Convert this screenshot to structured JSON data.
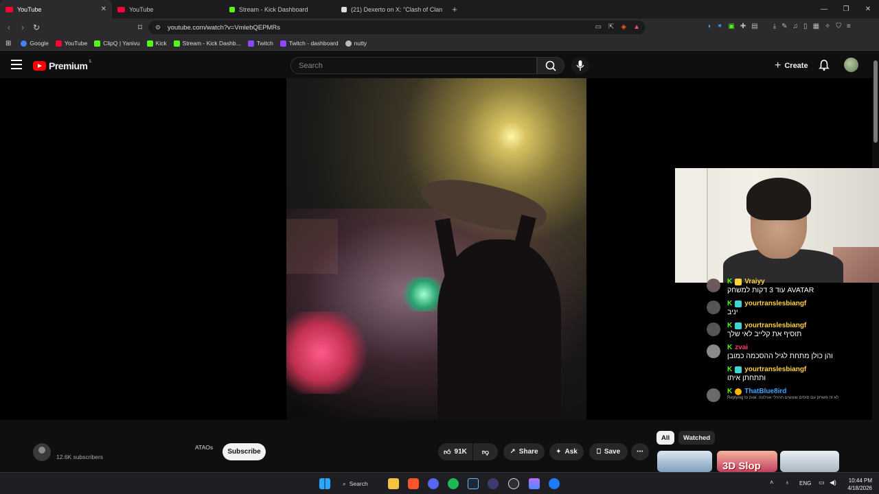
{
  "browser": {
    "tabs": [
      {
        "title": "YouTube",
        "active": true,
        "favicon_color": "#ff0033"
      },
      {
        "title": "YouTube",
        "active": false,
        "favicon_color": "#ff0033"
      },
      {
        "title": "Stream - Kick Dashboard",
        "active": false,
        "favicon_color": "#53fc18"
      },
      {
        "title": "(21) Dexerto on X: \"Clash of Clans ha",
        "active": false,
        "favicon_color": "#dddddd"
      }
    ],
    "new_tab": "+",
    "url": "youtube.com/watch?v=VmlebQEPMRs",
    "bookmarks": [
      {
        "label": "Google",
        "color": "#4285f4"
      },
      {
        "label": "YouTube",
        "color": "#ff0033"
      },
      {
        "label": "ClipQ | Yanivu",
        "color": "#53fc18"
      },
      {
        "label": "Kick",
        "color": "#53fc18"
      },
      {
        "label": "Stream - Kick Dashb...",
        "color": "#53fc18"
      },
      {
        "label": "Twitch",
        "color": "#9146ff"
      },
      {
        "label": "Twitch - dashboard",
        "color": "#9146ff"
      },
      {
        "label": "nutty",
        "color": "#bbbbbb"
      }
    ]
  },
  "youtube": {
    "logo_text": "Premium",
    "region": "IL",
    "search_placeholder": "Search",
    "create_label": "Create",
    "channel_name": "ATAOs",
    "subscribers": "12.6K subscribers",
    "subscribe_label": "Subscribe",
    "likes": "91K",
    "share_label": "Share",
    "ask_label": "Ask",
    "save_label": "Save",
    "chips": [
      "All",
      "Watched"
    ],
    "thumb_text": "3D Slop"
  },
  "chat": {
    "messages": [
      {
        "user": "Vraiyy",
        "user_color": "#ffd23f",
        "text": "עוד 3 דקות למשחק AVATAR"
      },
      {
        "user": "yourtranslesbiangf",
        "user_color": "#ffd23f",
        "text": "יניב"
      },
      {
        "user": "yourtranslesbiangf",
        "user_color": "#ffd23f",
        "text": "תוסיף את קלייב לאי שלך"
      },
      {
        "user": "zvai",
        "user_color": "#ff3b6b",
        "text": "והן כולן מתחת לגיל ההסכמה כמובן"
      },
      {
        "user": "yourtranslesbiangf",
        "user_color": "#ffd23f",
        "text": "ותתחתן איתו"
      },
      {
        "user": "ThatBlue8ird",
        "user_color": "#3ea6ff",
        "text": "",
        "reply": "Replying to zvai: לא זה משחק עם סוסים שעושים תרגילי אגילטה"
      }
    ]
  },
  "taskbar": {
    "search_label": "Search",
    "lang": "ENG",
    "time": "10:44 PM",
    "date": "4/18/2026"
  }
}
